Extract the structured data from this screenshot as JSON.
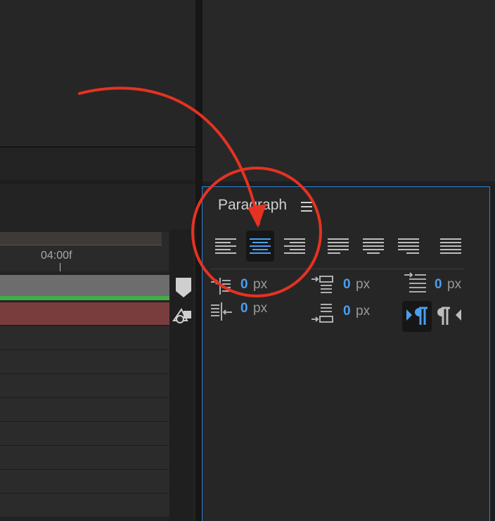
{
  "timeline": {
    "time_label": "04:00f"
  },
  "paragraph": {
    "title": "Paragraph",
    "align_buttons": [
      {
        "name": "align-left",
        "selected": false
      },
      {
        "name": "align-center",
        "selected": true
      },
      {
        "name": "align-right",
        "selected": false
      },
      {
        "name": "justify-last-left",
        "selected": false
      },
      {
        "name": "justify-last-center",
        "selected": false
      },
      {
        "name": "justify-last-right",
        "selected": false
      },
      {
        "name": "justify-all",
        "selected": false
      }
    ],
    "indent_left": {
      "value": "0",
      "unit": "px"
    },
    "indent_right": {
      "value": "0",
      "unit": "px"
    },
    "space_before": {
      "value": "0",
      "unit": "px"
    },
    "space_after": {
      "value": "0",
      "unit": "px"
    },
    "first_line_indent": {
      "value": "0",
      "unit": "px"
    }
  },
  "colors": {
    "panel_bg": "#262626",
    "accent_blue": "#4a9ff0",
    "panel_border": "#2d82d6",
    "annotation_red": "#e63222",
    "layer_green": "#3fae4a",
    "layer_red": "#7a3d3d"
  }
}
